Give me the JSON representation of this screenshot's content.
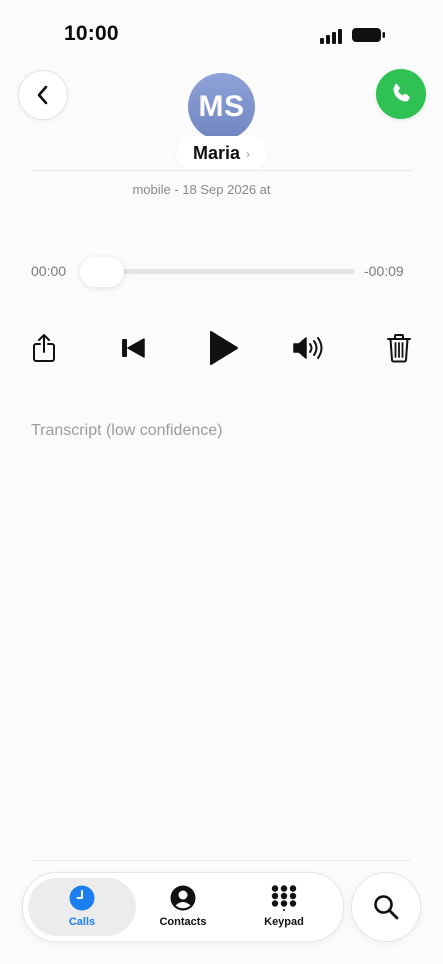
{
  "status_bar": {
    "time": "10:00"
  },
  "header": {
    "avatar_initials": "MS",
    "contact_name": "Maria",
    "name_chevron": "›",
    "meta": "mobile - 18 Sep 2026 at"
  },
  "player": {
    "elapsed": "00:00",
    "remaining": "-00:09",
    "progress": 0
  },
  "transcript": {
    "label": "Transcript (low confidence)"
  },
  "tabs": [
    {
      "label": "Calls",
      "icon": "clock-icon",
      "active": true
    },
    {
      "label": "Contacts",
      "icon": "person-circle-icon",
      "active": false
    },
    {
      "label": "Keypad",
      "icon": "keypad-icon",
      "active": false
    }
  ],
  "colors": {
    "call_green": "#2fc154",
    "tab_active_blue": "#1b7ff0"
  }
}
